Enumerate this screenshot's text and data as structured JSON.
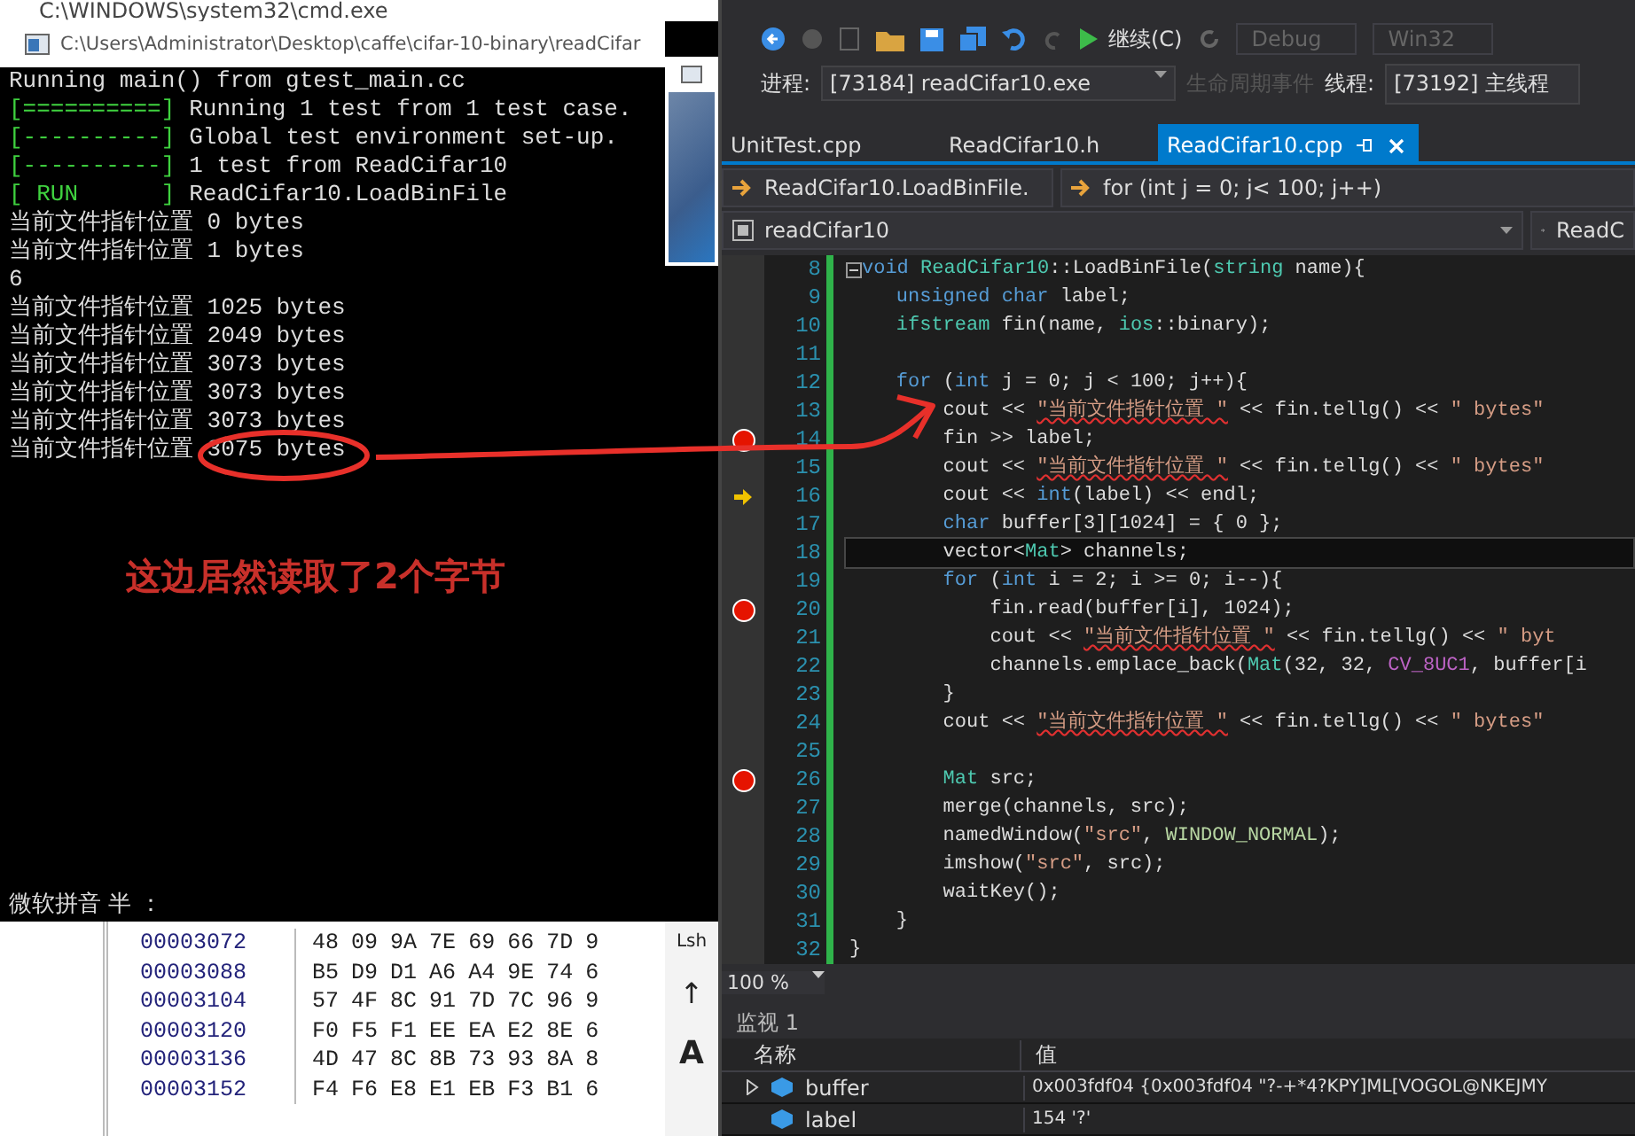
{
  "cmd_window": {
    "title": "C:\\WINDOWS\\system32\\cmd.exe"
  },
  "console_window": {
    "title": "C:\\Users\\Administrator\\Desktop\\caffe\\cifar-10-binary\\readCifar",
    "lines": [
      {
        "text": "Running main() from gtest_main.cc"
      },
      {
        "tag": "[==========]",
        "text": "Running 1 test from 1 test case."
      },
      {
        "tag": "[----------]",
        "text": "Global test environment set-up."
      },
      {
        "tag": "[----------]",
        "text": "1 test from ReadCifar10"
      },
      {
        "tag": "[ RUN      ]",
        "text": "ReadCifar10.LoadBinFile"
      },
      {
        "text": "当前文件指针位置 0 bytes"
      },
      {
        "text": "当前文件指针位置 1 bytes"
      },
      {
        "text": "6"
      },
      {
        "text": "当前文件指针位置 1025 bytes"
      },
      {
        "text": "当前文件指针位置 2049 bytes"
      },
      {
        "text": "当前文件指针位置 3073 bytes"
      },
      {
        "text": "当前文件指针位置 3073 bytes"
      },
      {
        "text": "当前文件指针位置 3073 bytes"
      },
      {
        "text": "当前文件指针位置 3075 bytes"
      }
    ],
    "annotation": "这边居然读取了2个字节",
    "ime_status": "微软拼音 半 ："
  },
  "hex_viewer": {
    "rows": [
      {
        "address": "00003072",
        "bytes": [
          "48",
          "09",
          "9A",
          "7E",
          "69",
          "66",
          "7D",
          "9"
        ]
      },
      {
        "address": "00003088",
        "bytes": [
          "B5",
          "D9",
          "D1",
          "A6",
          "A4",
          "9E",
          "74",
          "6"
        ]
      },
      {
        "address": "00003104",
        "bytes": [
          "57",
          "4F",
          "8C",
          "91",
          "7D",
          "7C",
          "96",
          "9"
        ]
      },
      {
        "address": "00003120",
        "bytes": [
          "F0",
          "F5",
          "F1",
          "EE",
          "EA",
          "E2",
          "8E",
          "6"
        ]
      },
      {
        "address": "00003136",
        "bytes": [
          "4D",
          "47",
          "8C",
          "8B",
          "73",
          "93",
          "8A",
          "8"
        ]
      },
      {
        "address": "00003152",
        "bytes": [
          "F4",
          "F6",
          "E8",
          "E1",
          "EB",
          "F3",
          "B1",
          "6"
        ]
      }
    ],
    "side_keys": [
      "Lsh",
      "↑",
      "A"
    ]
  },
  "toolbar": {
    "continue": "继续(C)",
    "configuration": "Debug",
    "platform": "Win32"
  },
  "debug_bar": {
    "process_label": "进程:",
    "process": "[73184] readCifar10.exe",
    "lifecycle": "生命周期事件",
    "lifecycle_disabled": true,
    "thread_label": "线程:",
    "thread": "[73192] 主线程"
  },
  "tabs": [
    {
      "label": "UnitTest.cpp",
      "selected": false
    },
    {
      "label": "ReadCifar10.h",
      "selected": false
    },
    {
      "label": "ReadCifar10.cpp",
      "selected": true
    }
  ],
  "nav_bar": {
    "scope": "ReadCifar10.LoadBinFile.",
    "member": "for (int j = 0; j< 100; j++)",
    "project": "readCifar10",
    "right": "ReadC"
  },
  "code_lines": [
    {
      "number": "8",
      "fold": true,
      "segments": [
        {
          "t": "void ",
          "kind": "kw"
        },
        {
          "t": "ReadCifar10",
          "kind": "type"
        },
        {
          "t": "::LoadBinFile(",
          "kind": "plain"
        },
        {
          "t": "string",
          "kind": "type"
        },
        {
          "t": " name){",
          "kind": "plain"
        }
      ]
    },
    {
      "number": "9",
      "segments": [
        {
          "t": "    unsigned char",
          "kind": "kw"
        },
        {
          "t": " label;",
          "kind": "plain"
        }
      ]
    },
    {
      "number": "10",
      "segments": [
        {
          "t": "    ifstream",
          "kind": "type"
        },
        {
          "t": " fin(name, ",
          "kind": "plain"
        },
        {
          "t": "ios",
          "kind": "type"
        },
        {
          "t": "::binary);",
          "kind": "plain"
        }
      ]
    },
    {
      "number": "11"
    },
    {
      "number": "12",
      "segments": [
        {
          "t": "    for",
          "kind": "kw"
        },
        {
          "t": " (",
          "kind": "plain"
        },
        {
          "t": "int",
          "kind": "kw"
        },
        {
          "t": " j = 0; j < 100; j++){",
          "kind": "plain"
        }
      ]
    },
    {
      "number": "13",
      "segments": [
        {
          "t": "        cout << ",
          "kind": "plain"
        },
        {
          "t": "\"当前文件指针位置 \"",
          "kind": "strerr"
        },
        {
          "t": " << fin.tellg() << ",
          "kind": "plain"
        },
        {
          "t": "\" bytes\"",
          "kind": "str"
        }
      ]
    },
    {
      "number": "14",
      "breakpoint": true,
      "segments": [
        {
          "t": "        fin >> label;",
          "kind": "plain"
        }
      ]
    },
    {
      "number": "15",
      "segments": [
        {
          "t": "        cout << ",
          "kind": "plain"
        },
        {
          "t": "\"当前文件指针位置 \"",
          "kind": "strerr"
        },
        {
          "t": " << fin.tellg() << ",
          "kind": "plain"
        },
        {
          "t": "\" bytes\"",
          "kind": "str"
        }
      ]
    },
    {
      "number": "16",
      "current": true,
      "segments": [
        {
          "t": "        cout << ",
          "kind": "plain"
        },
        {
          "t": "int",
          "kind": "kw"
        },
        {
          "t": "(label) << endl;",
          "kind": "plain"
        }
      ]
    },
    {
      "number": "17",
      "segments": [
        {
          "t": "        char",
          "kind": "kw"
        },
        {
          "t": " buffer[3][1024] = { 0 };",
          "kind": "plain"
        }
      ]
    },
    {
      "number": "18",
      "cursor": true,
      "segments": [
        {
          "t": "        vector<",
          "kind": "plain"
        },
        {
          "t": "Mat",
          "kind": "type"
        },
        {
          "t": "> channels;",
          "kind": "plain"
        }
      ]
    },
    {
      "number": "19",
      "segments": [
        {
          "t": "        for",
          "kind": "kw"
        },
        {
          "t": " (",
          "kind": "plain"
        },
        {
          "t": "int",
          "kind": "kw"
        },
        {
          "t": " i = 2; i >= 0; i--){",
          "kind": "plain"
        }
      ]
    },
    {
      "number": "20",
      "breakpoint": true,
      "segments": [
        {
          "t": "            fin.read(buffer[i], 1024);",
          "kind": "plain"
        }
      ]
    },
    {
      "number": "21",
      "segments": [
        {
          "t": "            cout << ",
          "kind": "plain"
        },
        {
          "t": "\"当前文件指针位置 \"",
          "kind": "strerr"
        },
        {
          "t": " << fin.tellg() << ",
          "kind": "plain"
        },
        {
          "t": "\" byt",
          "kind": "str"
        }
      ]
    },
    {
      "number": "22",
      "segments": [
        {
          "t": "            channels.emplace_back(",
          "kind": "plain"
        },
        {
          "t": "Mat",
          "kind": "type"
        },
        {
          "t": "(32, 32, ",
          "kind": "plain"
        },
        {
          "t": "CV_8UC1",
          "kind": "macro"
        },
        {
          "t": ", buffer[i",
          "kind": "plain"
        }
      ]
    },
    {
      "number": "23",
      "segments": [
        {
          "t": "        }",
          "kind": "plain"
        }
      ]
    },
    {
      "number": "24",
      "segments": [
        {
          "t": "        cout << ",
          "kind": "plain"
        },
        {
          "t": "\"当前文件指针位置 \"",
          "kind": "strerr"
        },
        {
          "t": " << fin.tellg() << ",
          "kind": "plain"
        },
        {
          "t": "\" bytes\"",
          "kind": "str"
        }
      ]
    },
    {
      "number": "25"
    },
    {
      "number": "26",
      "breakpoint": true,
      "segments": [
        {
          "t": "        Mat",
          "kind": "type"
        },
        {
          "t": " src;",
          "kind": "plain"
        }
      ]
    },
    {
      "number": "27",
      "segments": [
        {
          "t": "        merge(channels, src);",
          "kind": "plain"
        }
      ]
    },
    {
      "number": "28",
      "segments": [
        {
          "t": "        namedWindow(",
          "kind": "plain"
        },
        {
          "t": "\"src\"",
          "kind": "str"
        },
        {
          "t": ", ",
          "kind": "plain"
        },
        {
          "t": "WINDOW_NORMAL",
          "kind": "enum"
        },
        {
          "t": ");",
          "kind": "plain"
        }
      ]
    },
    {
      "number": "29",
      "segments": [
        {
          "t": "        imshow(",
          "kind": "plain"
        },
        {
          "t": "\"src\"",
          "kind": "str"
        },
        {
          "t": ", src);",
          "kind": "plain"
        }
      ]
    },
    {
      "number": "30",
      "segments": [
        {
          "t": "        waitKey();",
          "kind": "plain"
        }
      ]
    },
    {
      "number": "31",
      "segments": [
        {
          "t": "    }",
          "kind": "plain"
        }
      ]
    },
    {
      "number": "32",
      "segments": [
        {
          "t": "}",
          "kind": "plain"
        }
      ]
    }
  ],
  "zoom": "100 %",
  "watch": {
    "title": "监视 1",
    "columns": [
      "名称",
      "值"
    ],
    "rows": [
      {
        "name": "buffer",
        "value": "0x003fdf04 {0x003fdf04 \"?-+*4?KPY]ML[VOGOL@NKEJMY",
        "expandable": true
      },
      {
        "name": "label",
        "value": "154 '?'",
        "expandable": false
      }
    ]
  }
}
